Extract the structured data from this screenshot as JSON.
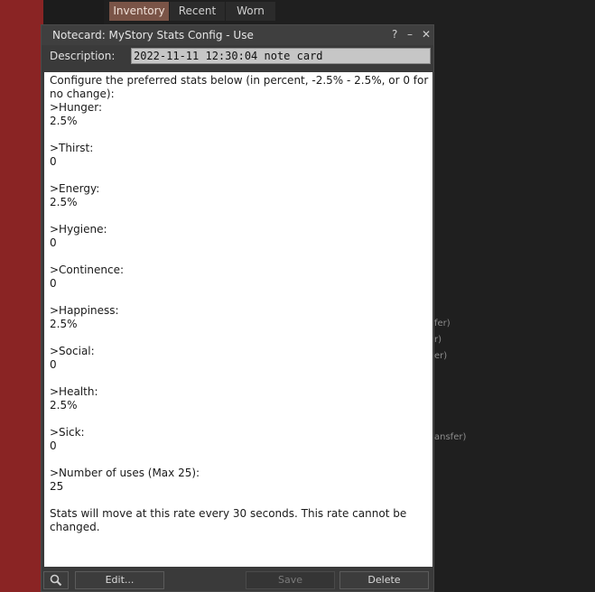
{
  "background": {
    "tabs": [
      "Inventory",
      "Recent",
      "Worn"
    ],
    "fragments": [
      "fer)",
      "r)",
      "er)",
      "ansfer)"
    ]
  },
  "notecard": {
    "title": "Notecard: MyStory Stats Config - Use",
    "help_glyph": "?",
    "minimize_glyph": "–",
    "close_glyph": "✕",
    "description_label": "Description:",
    "description_value": "2022-11-11 12:30:04 note card",
    "body": "Configure the preferred stats below (in percent, -2.5% - 2.5%, or 0 for no change):\n>Hunger:\n2.5%\n\n>Thirst:\n0\n\n>Energy:\n2.5%\n\n>Hygiene:\n0\n\n>Continence:\n0\n\n>Happiness:\n2.5%\n\n>Social:\n0\n\n>Health:\n2.5%\n\n>Sick:\n0\n\n>Number of uses (Max 25):\n25\n\nStats will move at this rate every 30 seconds. This rate cannot be changed.",
    "buttons": {
      "edit": "Edit...",
      "save": "Save",
      "delete": "Delete"
    }
  }
}
